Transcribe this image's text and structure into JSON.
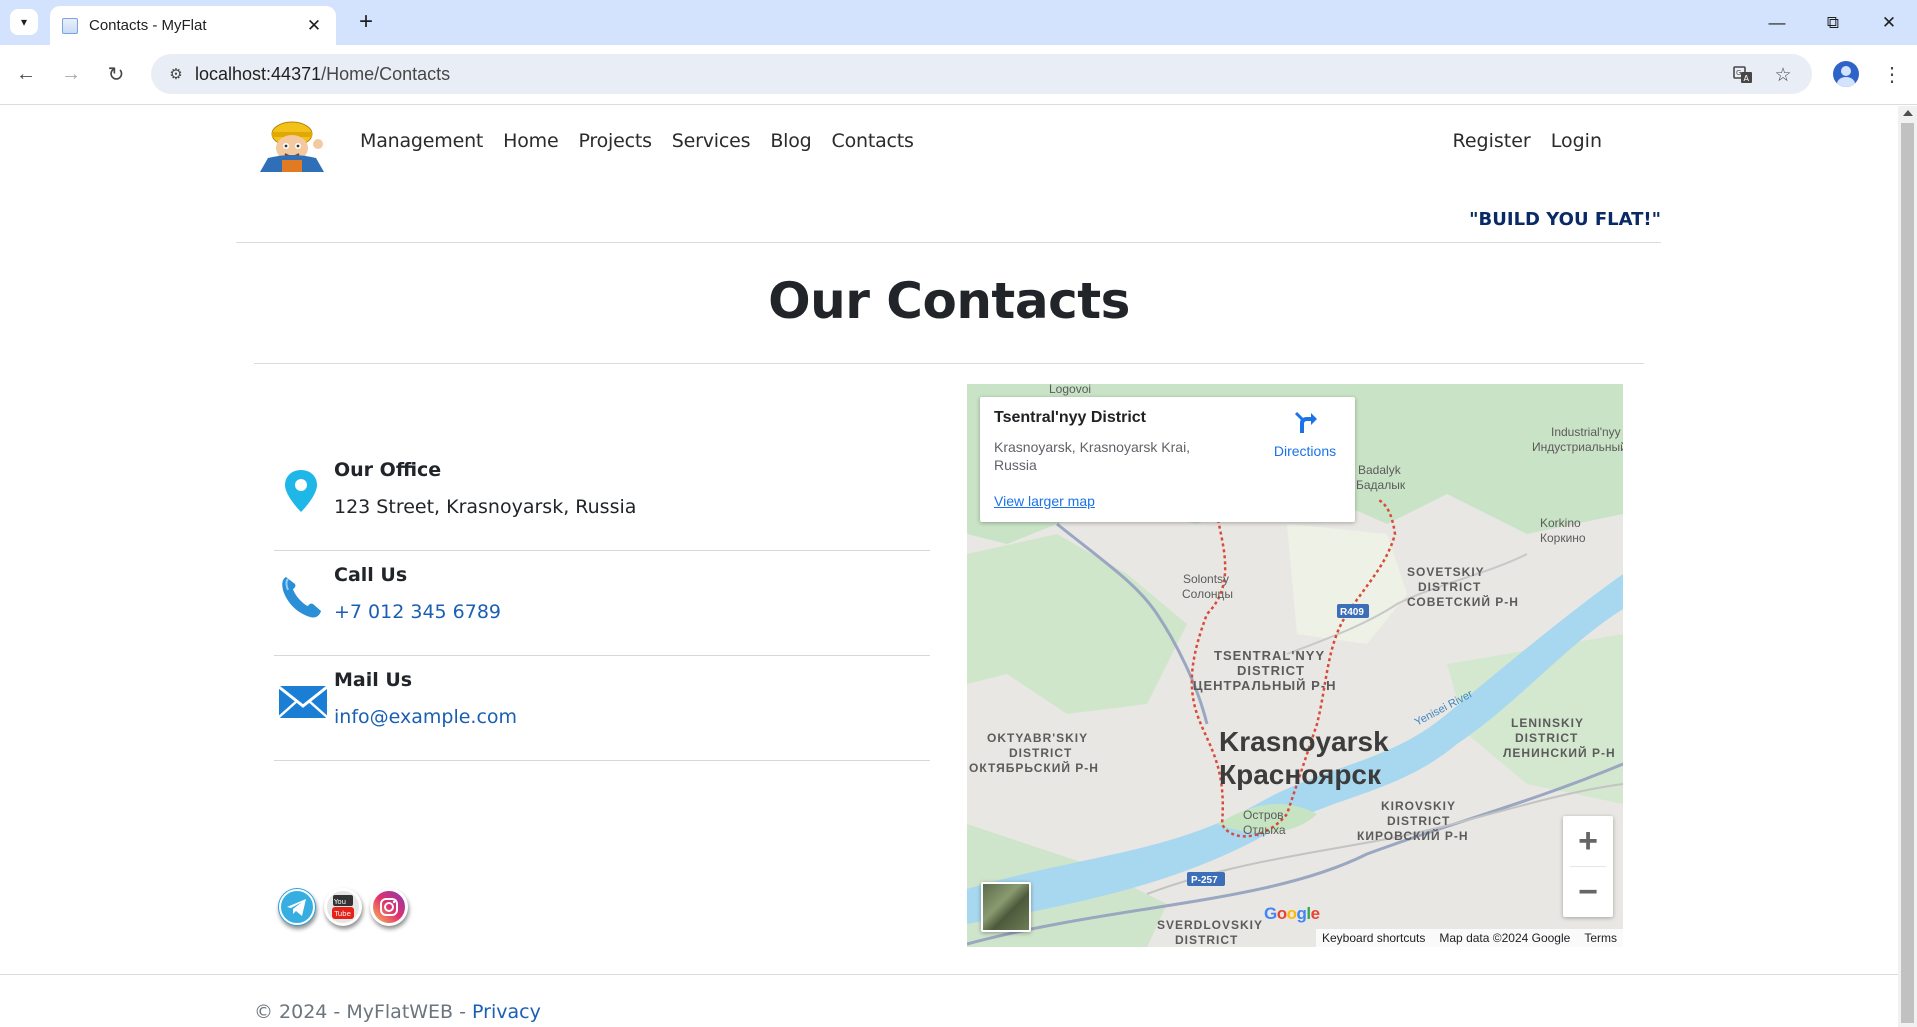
{
  "browser": {
    "tab_title": "Contacts - MyFlat",
    "url_host": "localhost:44371",
    "url_path": "/Home/Contacts"
  },
  "nav": {
    "items": [
      "Management",
      "Home",
      "Projects",
      "Services",
      "Blog",
      "Contacts"
    ],
    "register": "Register",
    "login": "Login",
    "slogan": "\"BUILD YOU FLAT!\""
  },
  "page": {
    "title": "Our Contacts"
  },
  "contacts": [
    {
      "label": "Our Office",
      "value": "123 Street, Krasnoyarsk, Russia",
      "icon": "location-pin-icon"
    },
    {
      "label": "Call Us",
      "value": "+7 012 345 6789",
      "icon": "phone-icon"
    },
    {
      "label": "Mail Us",
      "value": "info@example.com",
      "icon": "envelope-icon"
    }
  ],
  "socials": [
    "telegram-icon",
    "youtube-icon",
    "instagram-icon"
  ],
  "map": {
    "place_title": "Tsentral'nyy District",
    "place_address": "Krasnoyarsk, Krasnoyarsk Krai, Russia",
    "directions": "Directions",
    "view_larger": "View larger map",
    "labels": {
      "logovoi": "Logovoi",
      "industrial_en": "Industrial'nyy",
      "industrial_ru": "Индустриальный",
      "badalyk_en": "Badalyk",
      "badalyk_ru": "Бадалык",
      "korkino_en": "Korkino",
      "korkino_ru": "Коркино",
      "solontsy_en": "Solontsy",
      "solontsy_ru": "Солонцы",
      "sovetskiy_1": "SOVETSKIY",
      "sovetskiy_2": "DISTRICT",
      "sovetskiy_3": "СОВЕТСКИЙ Р-Н",
      "r409": "R409",
      "tsentral_1": "TSENTRAL'NYY",
      "tsentral_2": "DISTRICT",
      "tsentral_3": "ЦЕНТРАЛЬНЫЙ Р-Н",
      "yenisei": "Yenisei River",
      "leninskiy_1": "LENINSKIY",
      "leninskiy_2": "DISTRICT",
      "leninskiy_3": "ЛЕНИНСКИЙ Р-Н",
      "oktyabr_1": "OKTYABR'SKIY",
      "oktyabr_2": "DISTRICT",
      "oktyabr_3": "ОКТЯБРЬСКИЙ Р-Н",
      "city_en": "Krasnoyarsk",
      "city_ru": "Красноярск",
      "ostrov_1": "Остров",
      "ostrov_2": "Отдыха",
      "kirovskiy_1": "KIROVSKIY",
      "kirovskiy_2": "DISTRICT",
      "kirovskiy_3": "КИРОВСКИЙ Р-Н",
      "p257": "P-257",
      "sverdlovskiy_1": "SVERDLOVSKIY",
      "sverdlovskiy_2": "DISTRICT"
    },
    "zoom_in": "+",
    "zoom_out": "−",
    "google": "Google",
    "keyboard_shortcuts": "Keyboard shortcuts",
    "map_data": "Map data ©2024 Google",
    "terms": "Terms"
  },
  "footer": {
    "copyright": "© 2024 - MyFlatWEB - ",
    "privacy": "Privacy"
  },
  "colors": {
    "link": "#1a5fb4",
    "slogan": "#0a2a66",
    "browser_accent": "#d3e3fd"
  }
}
